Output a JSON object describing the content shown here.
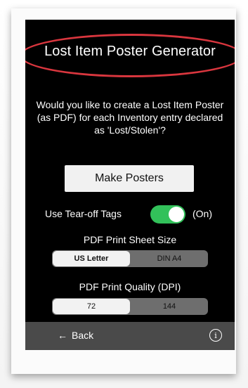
{
  "header": {
    "title": "Lost Item Poster Generator",
    "highlight_color": "#d9363e"
  },
  "prompt": {
    "text": "Would you like to create a Lost Item Poster (as PDF) for each Inventory entry declared as 'Lost/Stolen'?"
  },
  "actions": {
    "make_posters_label": "Make Posters"
  },
  "tear_off": {
    "label": "Use Tear-off Tags",
    "state_text": "(On)",
    "on": true,
    "accent_color": "#32c15a"
  },
  "sheet_size": {
    "label": "PDF Print Sheet Size",
    "options": [
      "US Letter",
      "DIN A4"
    ],
    "selected": "US Letter"
  },
  "quality": {
    "label": "PDF Print Quality (DPI)",
    "options": [
      "72",
      "144"
    ],
    "selected": "72"
  },
  "footer": {
    "back_label": "Back",
    "back_icon": "arrow-left-icon",
    "info_icon": "info-icon"
  }
}
